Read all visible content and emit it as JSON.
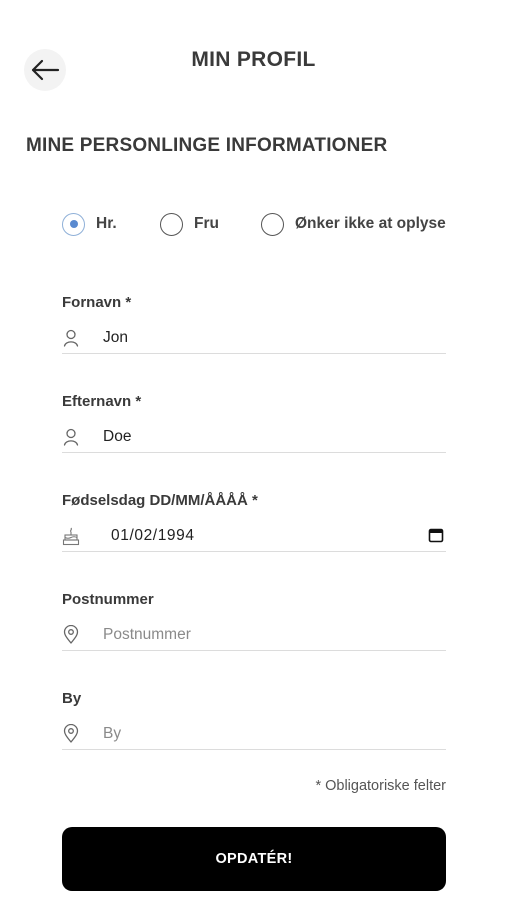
{
  "header": {
    "title": "MIN PROFIL",
    "back_icon": "arrow-left-icon"
  },
  "section": {
    "title": "MINE PERSONLINGE INFORMATIONER"
  },
  "salutation": {
    "selected": "Hr.",
    "options": [
      {
        "label": "Hr.",
        "selected": true
      },
      {
        "label": "Fru",
        "selected": false
      },
      {
        "label": "Ønker ikke at oplyse",
        "selected": false
      }
    ]
  },
  "fields": {
    "first_name": {
      "label": "Fornavn *",
      "value": "Jon",
      "icon": "user-icon"
    },
    "last_name": {
      "label": "Efternavn *",
      "value": "Doe",
      "icon": "user-icon"
    },
    "birthday": {
      "label": "Fødselsdag DD/MM/ÅÅÅÅ *",
      "value": "01/02/1994",
      "icon": "cake-icon",
      "picker_icon": "calendar-icon"
    },
    "postal_code": {
      "label": "Postnummer",
      "placeholder": "Postnummer",
      "value": "",
      "icon": "location-pin-icon"
    },
    "city": {
      "label": "By",
      "placeholder": "By",
      "value": "",
      "icon": "location-pin-icon"
    }
  },
  "required_note": "* Obligatoriske felter",
  "submit": {
    "label": "OPDATÉR!"
  },
  "colors": {
    "button_bg": "#000000",
    "radio_selected": "#5a8ad0",
    "underline": "#dcdcdc"
  }
}
